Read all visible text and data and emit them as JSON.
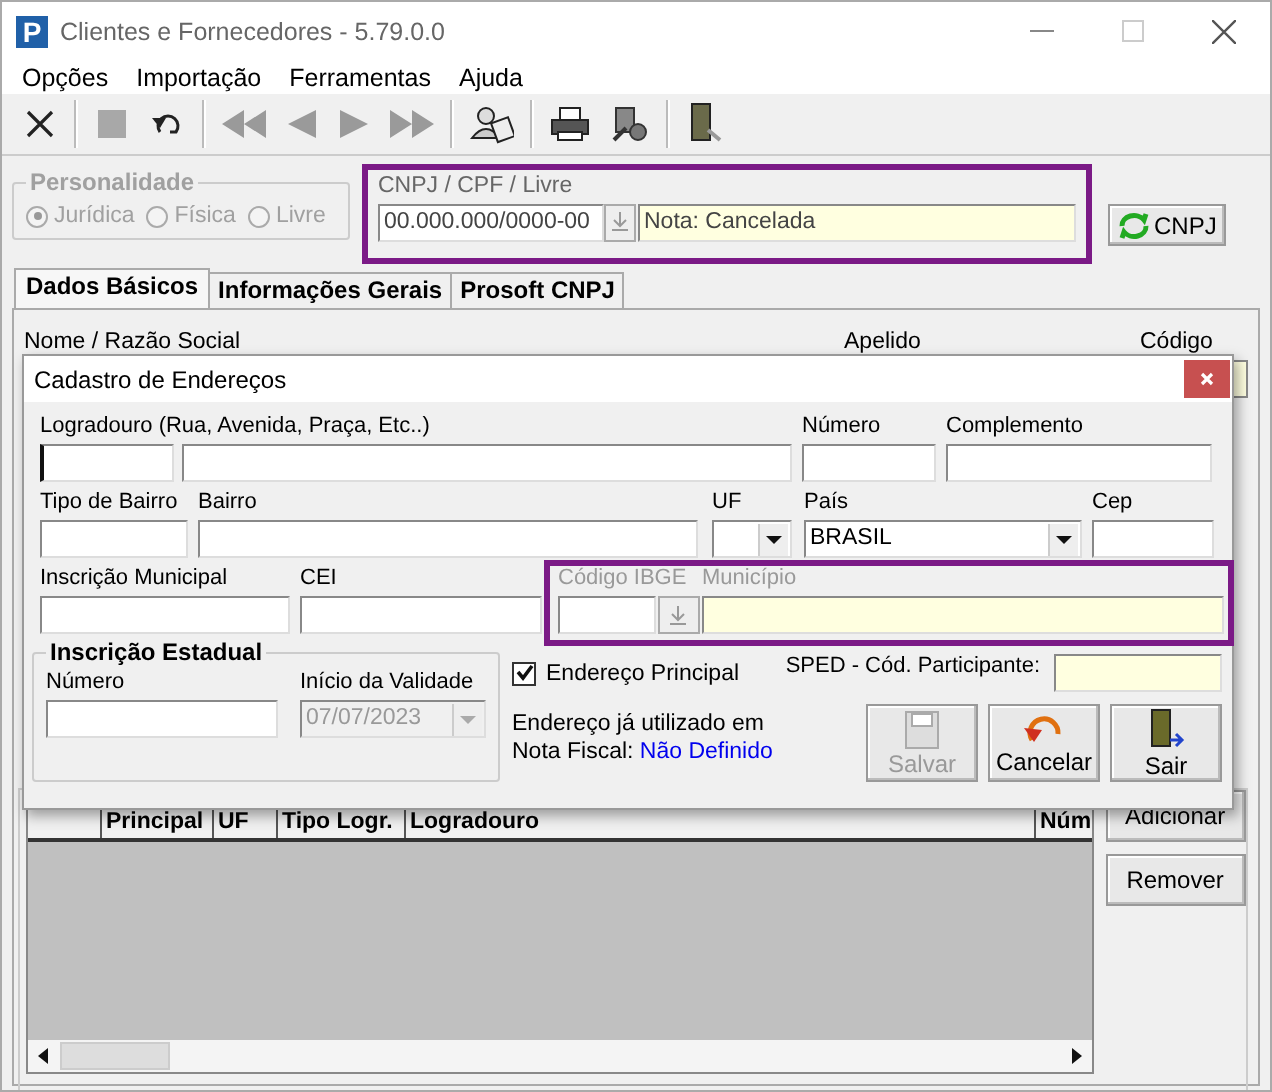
{
  "window": {
    "logo": "P",
    "title": "Clientes e Fornecedores - 5.79.0.0"
  },
  "menu": [
    "Opções",
    "Importação",
    "Ferramentas",
    "Ajuda"
  ],
  "toolbar": [
    {
      "kind": "close",
      "disabled": false
    },
    {
      "kind": "separator"
    },
    {
      "kind": "stop",
      "disabled": true
    },
    {
      "kind": "undo",
      "disabled": false
    },
    {
      "kind": "separator"
    },
    {
      "kind": "first",
      "disabled": true
    },
    {
      "kind": "prev",
      "disabled": true
    },
    {
      "kind": "next",
      "disabled": true
    },
    {
      "kind": "last",
      "disabled": true
    },
    {
      "kind": "separator"
    },
    {
      "kind": "users"
    },
    {
      "kind": "separator"
    },
    {
      "kind": "print"
    },
    {
      "kind": "tool"
    },
    {
      "kind": "separator"
    },
    {
      "kind": "exit"
    }
  ],
  "personalidade": {
    "label": "Personalidade",
    "disabled": true,
    "options": [
      {
        "label": "Jurídica",
        "selected": true
      },
      {
        "label": "Física",
        "selected": false
      },
      {
        "label": "Livre",
        "selected": false
      }
    ]
  },
  "document": {
    "label": "CNPJ / CPF / Livre",
    "value": "00.000.000/0000-00",
    "note": "Nota: Cancelada"
  },
  "cnpj_button": "CNPJ",
  "tabs": [
    {
      "label": "Dados Básicos",
      "selected": true
    },
    {
      "label": "Informações Gerais",
      "selected": false
    },
    {
      "label": "Prosoft CNPJ",
      "selected": false
    }
  ],
  "header_labels": [
    "Nome / Razão Social",
    "Apelido",
    "Código"
  ],
  "enderecos": {
    "columns": [
      "Principal",
      "UF",
      "Tipo Logr.",
      "Logradouro",
      "Núm"
    ],
    "buttons": [
      "Adicionar",
      "Remover"
    ]
  },
  "dialog": {
    "title": "Cadastro de Endereços",
    "logradouro": "Logradouro (Rua, Avenida, Praça, Etc..)",
    "numero": "Número",
    "complemento": "Complemento",
    "tipo_bairro": "Tipo de Bairro",
    "bairro": "Bairro",
    "uf": "UF",
    "pais": {
      "label": "País",
      "value": "BRASIL"
    },
    "cep": "Cep",
    "inscricao_municipal": "Inscrição Municipal",
    "cei": "CEI",
    "codigo_ibge": {
      "label": "Código IBGE",
      "disabled": true
    },
    "municipio": {
      "label": "Município",
      "disabled": true
    },
    "inscricao_estadual": {
      "title": "Inscrição Estadual",
      "numero": "Número",
      "inicio_label": "Início da Validade",
      "inicio_value": "07/07/2023",
      "inicio_disabled": true
    },
    "endereco_principal": {
      "label": "Endereço Principal",
      "checked": true
    },
    "sped_label": "SPED - Cód. Participante:",
    "used_text": "Endereço já utilizado em Nota Fiscal:",
    "used_link": "Não Definido",
    "buttons": [
      {
        "kind": "save",
        "label": "Salvar",
        "disabled": true
      },
      {
        "kind": "cancel",
        "label": "Cancelar",
        "disabled": false
      },
      {
        "kind": "exit",
        "label": "Sair",
        "disabled": false
      }
    ]
  }
}
